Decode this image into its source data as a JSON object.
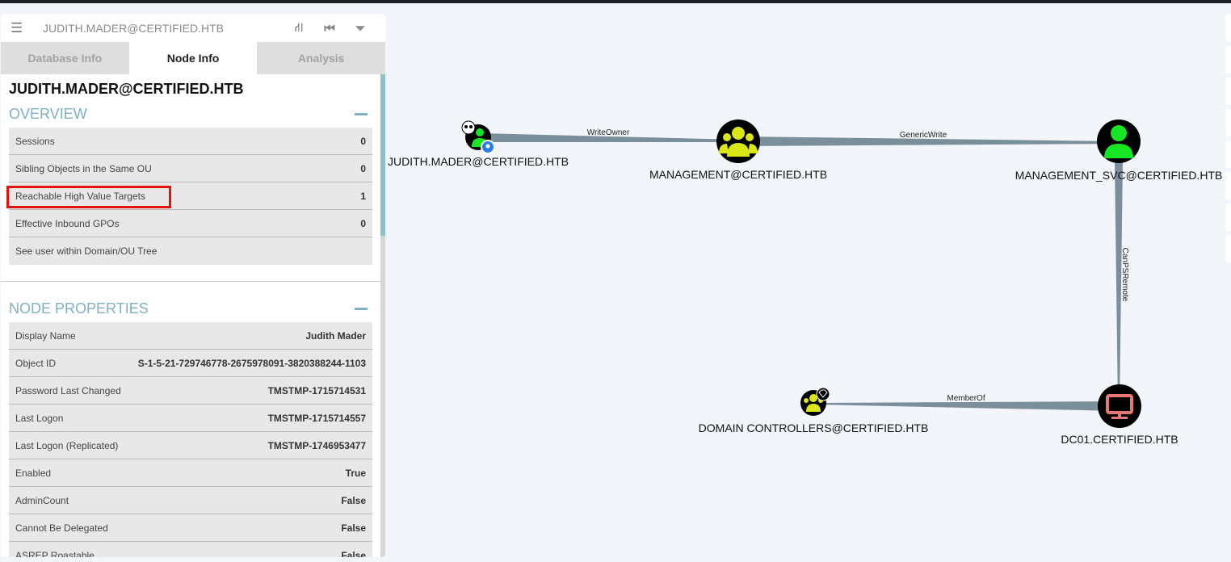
{
  "header": {
    "title": "JUDITH.MADER@CERTIFIED.HTB"
  },
  "tabs": [
    {
      "label": "Database Info"
    },
    {
      "label": "Node Info"
    },
    {
      "label": "Analysis"
    }
  ],
  "node": {
    "name": "JUDITH.MADER@CERTIFIED.HTB"
  },
  "overview": {
    "title": "OVERVIEW",
    "rows": [
      {
        "label": "Sessions",
        "value": "0"
      },
      {
        "label": "Sibling Objects in the Same OU",
        "value": "0"
      },
      {
        "label": "Reachable High Value Targets",
        "value": "1"
      },
      {
        "label": "Effective Inbound GPOs",
        "value": "0"
      },
      {
        "label": "See user within Domain/OU Tree",
        "value": ""
      }
    ]
  },
  "properties": {
    "title": "NODE PROPERTIES",
    "rows": [
      {
        "label": "Display Name",
        "value": "Judith Mader"
      },
      {
        "label": "Object ID",
        "value": "S-1-5-21-729746778-2675978091-3820388244-1103"
      },
      {
        "label": "Password Last Changed",
        "value": "TMSTMP-1715714531"
      },
      {
        "label": "Last Logon",
        "value": "TMSTMP-1715714557"
      },
      {
        "label": "Last Logon (Replicated)",
        "value": "TMSTMP-1746953477"
      },
      {
        "label": "Enabled",
        "value": "True"
      },
      {
        "label": "AdminCount",
        "value": "False"
      },
      {
        "label": "Cannot Be Delegated",
        "value": "False"
      },
      {
        "label": "ASREP Roastable",
        "value": "False"
      }
    ]
  },
  "graph": {
    "nodes": [
      {
        "label": "JUDITH.MADER@CERTIFIED.HTB",
        "type": "user-owned"
      },
      {
        "label": "MANAGEMENT@CERTIFIED.HTB",
        "type": "group"
      },
      {
        "label": "MANAGEMENT_SVC@CERTIFIED.HTB",
        "type": "user"
      },
      {
        "label": "DC01.CERTIFIED.HTB",
        "type": "computer"
      },
      {
        "label": "DOMAIN CONTROLLERS@CERTIFIED.HTB",
        "type": "group-highvalue"
      }
    ],
    "edges": [
      {
        "label": "WriteOwner"
      },
      {
        "label": "GenericWrite"
      },
      {
        "label": "CanPSRemote"
      },
      {
        "label": "MemberOf"
      }
    ],
    "colors": {
      "edge": "#7a8f9b",
      "user": "#17e625",
      "group": "#dbe617",
      "computer": "#e67873"
    }
  }
}
